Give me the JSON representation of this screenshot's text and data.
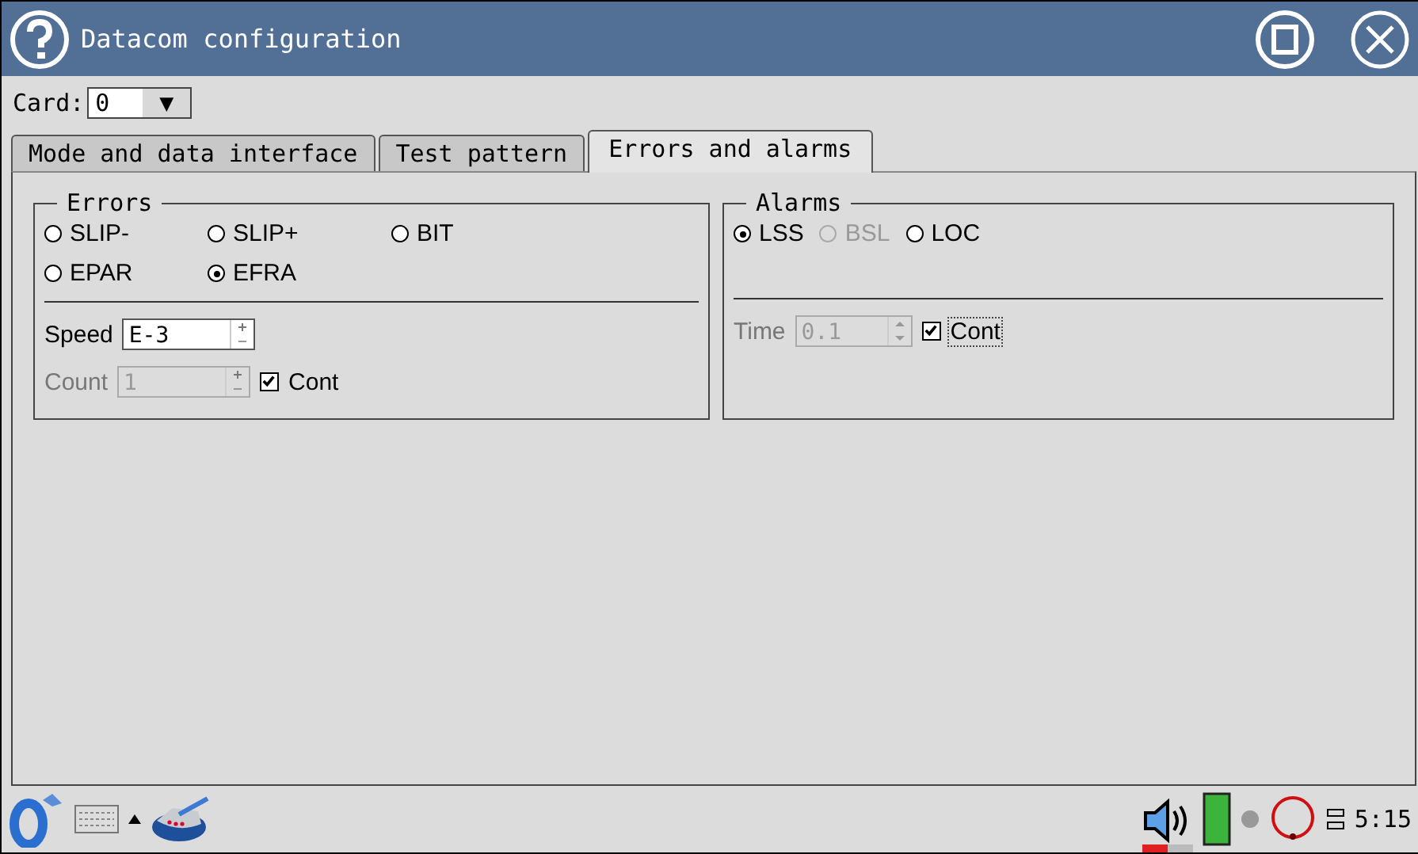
{
  "window": {
    "title": "Datacom configuration"
  },
  "card": {
    "label": "Card:",
    "value": "0",
    "arrow": "▼"
  },
  "tabs": [
    {
      "label": "Mode and data interface",
      "selected": false
    },
    {
      "label": "Test pattern",
      "selected": false
    },
    {
      "label": "Errors and  alarms",
      "selected": true
    }
  ],
  "errors": {
    "title": "Errors",
    "options": [
      {
        "label": "SLIP-",
        "selected": false
      },
      {
        "label": "SLIP+",
        "selected": false
      },
      {
        "label": "BIT",
        "selected": false
      },
      {
        "label": "EPAR",
        "selected": false
      },
      {
        "label": "EFRA",
        "selected": true
      }
    ],
    "speed": {
      "label": "Speed",
      "value": "E-3",
      "disabled": false
    },
    "count": {
      "label": "Count",
      "value": "1",
      "disabled": true
    },
    "cont": {
      "label": "Cont",
      "checked": true,
      "focused": false
    }
  },
  "alarms": {
    "title": "Alarms",
    "options": [
      {
        "label": "LSS",
        "selected": true,
        "disabled": false
      },
      {
        "label": "BSL",
        "selected": false,
        "disabled": true
      },
      {
        "label": "LOC",
        "selected": false,
        "disabled": false
      }
    ],
    "time": {
      "label": "Time",
      "value": "0.1",
      "disabled": true
    },
    "cont": {
      "label": "Cont",
      "checked": true,
      "focused": true
    }
  },
  "taskbar": {
    "volume": {
      "level": 0.5
    },
    "clock": "5:15"
  }
}
